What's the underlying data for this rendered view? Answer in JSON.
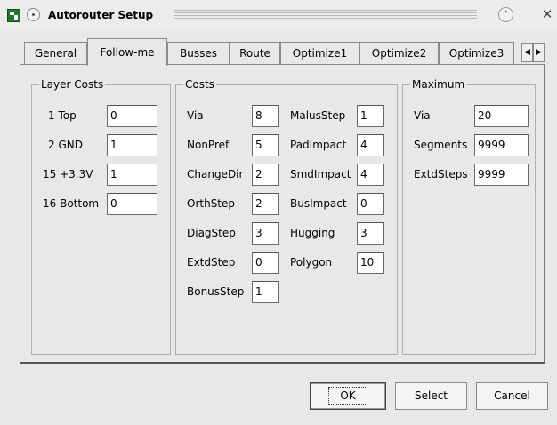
{
  "window": {
    "title": "Autorouter Setup"
  },
  "tabs": [
    {
      "label": "General"
    },
    {
      "label": "Follow-me"
    },
    {
      "label": "Busses"
    },
    {
      "label": "Route"
    },
    {
      "label": "Optimize1"
    },
    {
      "label": "Optimize2"
    },
    {
      "label": "Optimize3"
    }
  ],
  "tab_scroll": {
    "left": "◀",
    "right": "▶"
  },
  "layer_costs": {
    "title": "Layer Costs",
    "rows": [
      {
        "label": "1  Top",
        "value": "0"
      },
      {
        "label": "2  GND",
        "value": "1"
      },
      {
        "label": "15  +3.3V",
        "value": "1"
      },
      {
        "label": "16  Bottom",
        "value": "0"
      }
    ]
  },
  "costs": {
    "title": "Costs",
    "left": [
      {
        "label": "Via",
        "value": "8"
      },
      {
        "label": "NonPref",
        "value": "5"
      },
      {
        "label": "ChangeDir",
        "value": "2"
      },
      {
        "label": "OrthStep",
        "value": "2"
      },
      {
        "label": "DiagStep",
        "value": "3"
      },
      {
        "label": "ExtdStep",
        "value": "0"
      },
      {
        "label": "BonusStep",
        "value": "1"
      }
    ],
    "right": [
      {
        "label": "MalusStep",
        "value": "1"
      },
      {
        "label": "PadImpact",
        "value": "4"
      },
      {
        "label": "SmdImpact",
        "value": "4"
      },
      {
        "label": "BusImpact",
        "value": "0"
      },
      {
        "label": "Hugging",
        "value": "3"
      },
      {
        "label": "Polygon",
        "value": "10"
      }
    ]
  },
  "maximum": {
    "title": "Maximum",
    "rows": [
      {
        "label": "Via",
        "value": "20"
      },
      {
        "label": "Segments",
        "value": "9999"
      },
      {
        "label": "ExtdSteps",
        "value": "9999"
      }
    ]
  },
  "buttons": {
    "ok": "OK",
    "select": "Select",
    "cancel": "Cancel"
  }
}
